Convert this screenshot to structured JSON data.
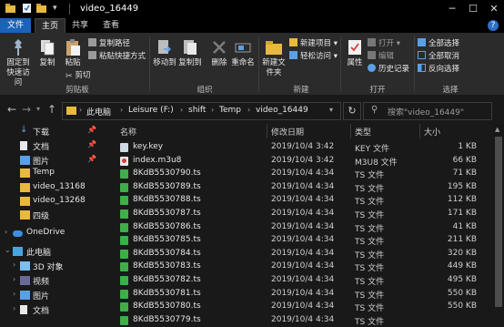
{
  "window": {
    "title": "video_16449",
    "controls": {
      "minimize": "─",
      "maximize": "☐",
      "close": "✕"
    }
  },
  "ribbon_tabs": [
    {
      "label": "文件",
      "state": "file"
    },
    {
      "label": "主页",
      "state": "active"
    },
    {
      "label": "共享",
      "state": ""
    },
    {
      "label": "查看",
      "state": ""
    }
  ],
  "help_label": "?",
  "ribbon": {
    "clipboard": {
      "pin_label": "固定到快速访问",
      "copy_label": "复制",
      "paste_label": "粘贴",
      "cut_label": "剪切",
      "copy_path_label": "复制路径",
      "paste_shortcut_label": "粘贴快捷方式",
      "group_label": "剪贴板"
    },
    "organize": {
      "move_to_label": "移动到",
      "copy_to_label": "复制到",
      "delete_label": "删除",
      "rename_label": "重命名",
      "group_label": "组织"
    },
    "new": {
      "new_folder_label": "新建文件夹",
      "new_item_label": "新建项目",
      "easy_access_label": "轻松访问",
      "group_label": "新建"
    },
    "open": {
      "properties_label": "属性",
      "open_label": "打开",
      "edit_label": "编辑",
      "history_label": "历史记录",
      "group_label": "打开"
    },
    "select": {
      "select_all_label": "全部选择",
      "select_none_label": "全部取消",
      "invert_label": "反向选择",
      "group_label": "选择"
    }
  },
  "address": {
    "crumbs": [
      "此电脑",
      "Leisure (F:)",
      "shift",
      "Temp",
      "video_16449"
    ],
    "search_placeholder": "搜索\"video_16449\""
  },
  "sidebar": [
    {
      "label": "下载",
      "icon": "download-icon",
      "pinned": true
    },
    {
      "label": "文档",
      "icon": "documents-icon",
      "pinned": true
    },
    {
      "label": "图片",
      "icon": "pictures-icon",
      "pinned": true
    },
    {
      "label": "Temp",
      "icon": "folder-icon",
      "pinned": false
    },
    {
      "label": "video_13168",
      "icon": "folder-icon",
      "pinned": false
    },
    {
      "label": "video_13268",
      "icon": "folder-icon",
      "pinned": false
    },
    {
      "label": "四级",
      "icon": "folder-icon",
      "pinned": false
    },
    {
      "label": "OneDrive",
      "icon": "onedrive-icon",
      "pinned": false
    },
    {
      "label": "此电脑",
      "icon": "this-pc-icon",
      "pinned": false
    },
    {
      "label": "3D 对象",
      "icon": "3d-objects-icon",
      "pinned": false
    },
    {
      "label": "视频",
      "icon": "videos-icon",
      "pinned": false
    },
    {
      "label": "图片",
      "icon": "pictures-icon",
      "pinned": false
    },
    {
      "label": "文档",
      "icon": "documents-icon",
      "pinned": false
    }
  ],
  "columns": {
    "name": "名称",
    "date": "修改日期",
    "type": "类型",
    "size": "大小"
  },
  "files": [
    {
      "name": "key.key",
      "date": "2019/10/4 3:42",
      "type": "KEY 文件",
      "size": "1 KB",
      "icon": "key-file-icon"
    },
    {
      "name": "index.m3u8",
      "date": "2019/10/4 3:42",
      "type": "M3U8 文件",
      "size": "66 KB",
      "icon": "m3u8-file-icon"
    },
    {
      "name": "8KdB5530790.ts",
      "date": "2019/10/4 4:34",
      "type": "TS 文件",
      "size": "71 KB",
      "icon": "ts-file-icon"
    },
    {
      "name": "8KdB5530789.ts",
      "date": "2019/10/4 4:34",
      "type": "TS 文件",
      "size": "195 KB",
      "icon": "ts-file-icon"
    },
    {
      "name": "8KdB5530788.ts",
      "date": "2019/10/4 4:34",
      "type": "TS 文件",
      "size": "112 KB",
      "icon": "ts-file-icon"
    },
    {
      "name": "8KdB5530787.ts",
      "date": "2019/10/4 4:34",
      "type": "TS 文件",
      "size": "171 KB",
      "icon": "ts-file-icon"
    },
    {
      "name": "8KdB5530786.ts",
      "date": "2019/10/4 4:34",
      "type": "TS 文件",
      "size": "41 KB",
      "icon": "ts-file-icon"
    },
    {
      "name": "8KdB5530785.ts",
      "date": "2019/10/4 4:34",
      "type": "TS 文件",
      "size": "211 KB",
      "icon": "ts-file-icon"
    },
    {
      "name": "8KdB5530784.ts",
      "date": "2019/10/4 4:34",
      "type": "TS 文件",
      "size": "320 KB",
      "icon": "ts-file-icon"
    },
    {
      "name": "8KdB5530783.ts",
      "date": "2019/10/4 4:34",
      "type": "TS 文件",
      "size": "449 KB",
      "icon": "ts-file-icon"
    },
    {
      "name": "8KdB5530782.ts",
      "date": "2019/10/4 4:34",
      "type": "TS 文件",
      "size": "495 KB",
      "icon": "ts-file-icon"
    },
    {
      "name": "8KdB5530781.ts",
      "date": "2019/10/4 4:34",
      "type": "TS 文件",
      "size": "550 KB",
      "icon": "ts-file-icon"
    },
    {
      "name": "8KdB5530780.ts",
      "date": "2019/10/4 4:34",
      "type": "TS 文件",
      "size": "550 KB",
      "icon": "ts-file-icon"
    },
    {
      "name": "8KdB5530779.ts",
      "date": "2019/10/4 4:34",
      "type": "TS 文件",
      "size": "",
      "icon": "ts-file-icon"
    }
  ],
  "colors": {
    "accent": "#1a63b8",
    "folder": "#e8b93e",
    "ts_icon": "#3fae49",
    "background": "#191919"
  }
}
